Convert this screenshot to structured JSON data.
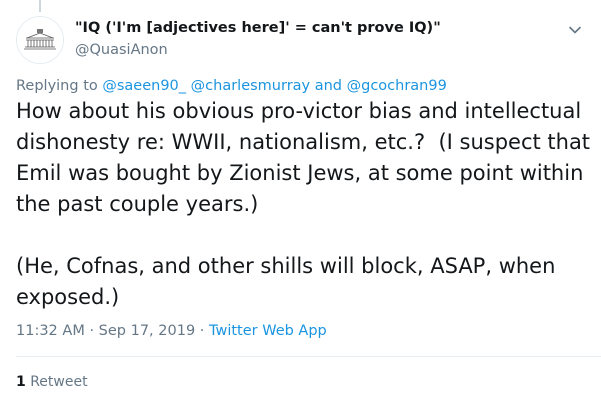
{
  "author": {
    "display_name": "\"IQ ('I'm [adjectives here]' = can't prove IQ)\"",
    "handle": "@QuasiAnon"
  },
  "reply_context": {
    "prefix": "Replying to",
    "mention_1": "@saeen90_",
    "mention_2": "@charlesmurray",
    "conjunction": "and",
    "mention_3": "@gcochran99"
  },
  "tweet": {
    "line_1": "How about his obvious pro-victor bias and intellectual",
    "line_2": "dishonesty re: WWII, nationalism, etc.?  (I suspect that",
    "line_3": "Emil was bought by Zionist Jews, at some point within",
    "line_4": "the past couple years.)",
    "line_5": "(He, Cofnas, and other shills will block, ASAP, when",
    "line_6": "exposed.)"
  },
  "meta": {
    "time": "11:32 AM",
    "separator_1": "·",
    "date": "Sep 17, 2019",
    "separator_2": "·",
    "source": "Twitter Web App"
  },
  "stats": {
    "retweet_count": "1",
    "retweet_label": "Retweet"
  },
  "icons": {
    "caret": "chevron-down-icon",
    "avatar": "building-illustration"
  },
  "colors": {
    "link": "#1b95e0",
    "secondary_text": "#657786",
    "primary_text": "#14171a",
    "divider": "#e6ecf0"
  }
}
